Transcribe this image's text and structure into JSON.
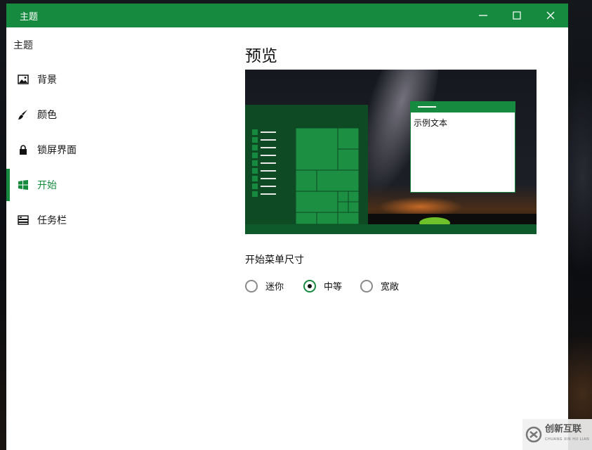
{
  "window": {
    "title": "主题",
    "controls": {
      "minimize": "minimize",
      "maximize": "maximize",
      "close": "close"
    },
    "accent_color": "#168b3f"
  },
  "sidebar": {
    "header": "主题",
    "items": [
      {
        "label": "背景",
        "icon": "picture-icon",
        "selected": false
      },
      {
        "label": "颜色",
        "icon": "brush-icon",
        "selected": false
      },
      {
        "label": "锁屏界面",
        "icon": "lock-icon",
        "selected": false
      },
      {
        "label": "开始",
        "icon": "windows-icon",
        "selected": true
      },
      {
        "label": "任务栏",
        "icon": "taskbar-icon",
        "selected": false
      }
    ]
  },
  "main": {
    "title": "预览",
    "preview": {
      "sample_text": "示例文本"
    },
    "start_size": {
      "label": "开始菜单尺寸",
      "options": [
        {
          "label": "迷你",
          "checked": false
        },
        {
          "label": "中等",
          "checked": true
        },
        {
          "label": "宽敞",
          "checked": false
        }
      ]
    }
  },
  "watermark": {
    "text": "创新互联",
    "sub": "CHUANG XIN HU LIAN"
  }
}
